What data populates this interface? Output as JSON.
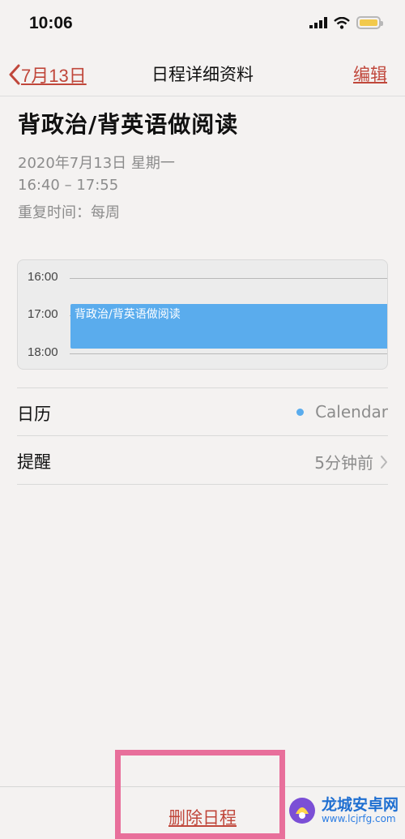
{
  "status_bar": {
    "time": "10:06"
  },
  "nav": {
    "back_label": "7月13日",
    "title": "日程详细资料",
    "edit_label": "编辑"
  },
  "event": {
    "title": "背政治/背英语做阅读",
    "date": "2020年7月13日 星期一",
    "time_range": "16:40 – 17:55",
    "repeat": "重复时间：每周"
  },
  "timeline": {
    "hours": [
      "16:00",
      "17:00",
      "18:00"
    ],
    "block_label": "背政治/背英语做阅读",
    "block_color": "#5aaced"
  },
  "details": {
    "calendar_label": "日历",
    "calendar_value": "Calendar",
    "alert_label": "提醒",
    "alert_value": "5分钟前"
  },
  "toolbar": {
    "delete_label": "删除日程"
  },
  "watermark": {
    "brand": "龙城安卓网",
    "url": "www.lcjrfg.com"
  },
  "colors": {
    "accent": "#c0473b",
    "highlight": "#e86f9b",
    "event_blue": "#5aaced"
  }
}
